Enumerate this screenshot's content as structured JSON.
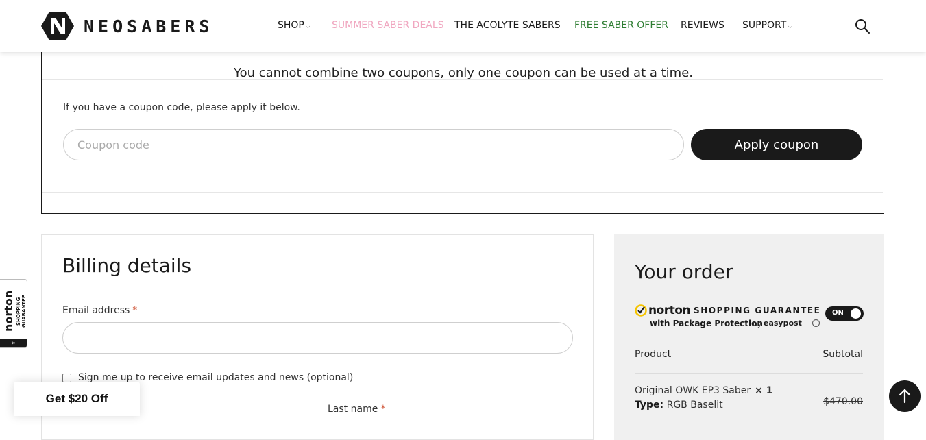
{
  "header": {
    "logo_text": "NEOSABERS",
    "nav": [
      {
        "label": "SHOP",
        "has_dropdown": true,
        "color": "#1a1a1a"
      },
      {
        "label": "SUMMER SABER DEALS",
        "has_dropdown": false,
        "color": "#f0a7c0"
      },
      {
        "label": "THE ACOLYTE SABERS",
        "has_dropdown": false,
        "color": "#1a1a1a"
      },
      {
        "label": "FREE SABER OFFER",
        "has_dropdown": false,
        "color": "#2e7d32"
      },
      {
        "label": "REVIEWS",
        "has_dropdown": false,
        "color": "#1a1a1a"
      },
      {
        "label": "SUPPORT",
        "has_dropdown": true,
        "color": "#1a1a1a"
      }
    ]
  },
  "coupon": {
    "notice": "You cannot combine two coupons, only one coupon can be used at a time.",
    "prompt": "If you have a coupon code, please apply it below.",
    "input_placeholder": "Coupon code",
    "input_value": "",
    "button_label": "Apply coupon"
  },
  "billing": {
    "title": "Billing details",
    "email_label": "Email address",
    "required_mark": "*",
    "signup_label": "Sign me up to receive email updates and news (optional)",
    "last_name_label": "Last name"
  },
  "order": {
    "title": "Your order",
    "norton": {
      "brand": "norton",
      "guarantee": "SHOPPING GUARANTEE",
      "package_protection": "with Package Protection",
      "by": "by",
      "partner": "easypost",
      "toggle_label": "ON"
    },
    "columns": {
      "product": "Product",
      "subtotal": "Subtotal"
    },
    "items": [
      {
        "name": "Original OWK EP3 Saber",
        "qty": "× 1",
        "type_label": "Type:",
        "type_value": "RGB Baselit",
        "original_price": "$470.00"
      }
    ]
  },
  "side_badge": {
    "brand": "norton",
    "text": "SHOPPING GUARANTEE",
    "arrows": "»"
  },
  "promo": {
    "label": "Get $20 Off"
  },
  "colors": {
    "accent": "#1a1a1a",
    "deals_pink": "#f0a7c0",
    "offer_green": "#2e7d32",
    "required": "#d0573a"
  }
}
